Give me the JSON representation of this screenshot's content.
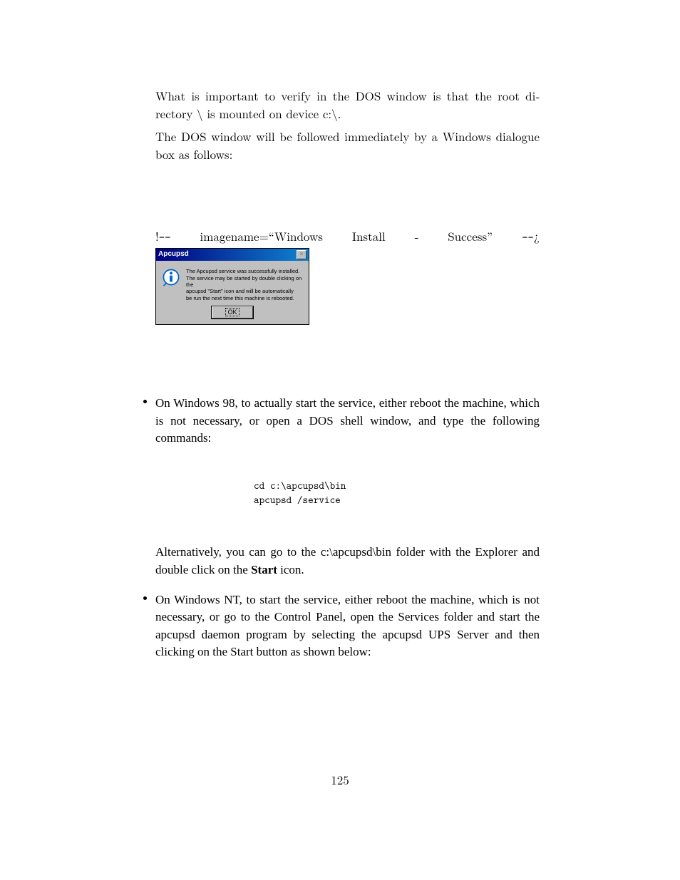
{
  "intro": {
    "p1_a": "What is important to verify in the DOS window is that the root di­rectory \\ is mounted on device c:\\.",
    "p2": "The DOS window will be followed immediately by a Windows dialogue box as follows:"
  },
  "image_comment": {
    "open": "!",
    "dashdash1": "--",
    "label_key": "imagename=“Windows",
    "label_install": "Install",
    "label_dash": "-",
    "label_success": "Success”",
    "dashdash2": "--",
    "inverted": "¿"
  },
  "dialog": {
    "title": "Apcupsd",
    "close_x": "×",
    "message": "The Apcupsd service was successfully installed.\nThe service may be started by double clicking on the\napcupsd \"Start\" icon and will be automatically\nbe run the next time this machine is rebooted.",
    "ok": "OK"
  },
  "bullets": {
    "b1": "On Windows 98, to actually start the service, either reboot the ma­chine, which is not necessary, or open a DOS shell window, and type the following commands:",
    "code": "cd c:\\apcupsd\\bin\napcupsd /service",
    "b1_post_a": "Alternatively, you can go to the c:\\apcupsd\\bin folder with the Ex­plorer and double click on the ",
    "b1_post_bold": "Start",
    "b1_post_b": " icon.",
    "b2": "On Windows NT, to start the service, either reboot the machine, which is not necessary, or go to the Control Panel, open the Services folder and start the apcupsd daemon program by selecting the apcupsd UPS Server and then clicking on the Start button as shown below:"
  },
  "page_number": "125"
}
